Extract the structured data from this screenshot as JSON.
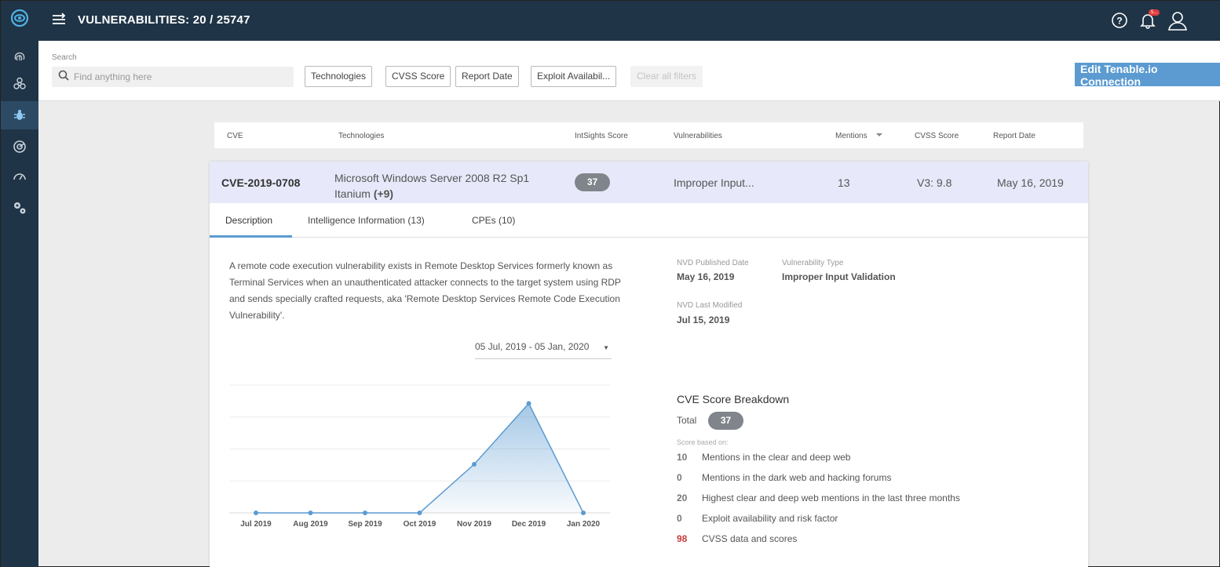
{
  "header": {
    "title": "VULNERABILITIES: 20 / 25747",
    "notification_count": "5..."
  },
  "search": {
    "label": "Search",
    "placeholder": "Find anything here"
  },
  "filters": [
    "Technologies",
    "CVSS Score",
    "Report Date",
    "Exploit Availabil...",
    "Clear all filters"
  ],
  "edit_button": "Edit Tenable.io Connection",
  "columns": [
    "CVE",
    "Technologies",
    "IntSights Score",
    "Vulnerabilities",
    "Mentions",
    "CVSS Score",
    "Report Date"
  ],
  "row": {
    "cve": "CVE-2019-0708",
    "tech": "Microsoft Windows Server 2008 R2 Sp1 Itanium",
    "tech_more": "(+9)",
    "score": "37",
    "vulnerability": "Improper Input...",
    "mentions": "13",
    "cvss": "V3: 9.8",
    "report_date": "May 16, 2019"
  },
  "tabs": [
    "Description",
    "Intelligence Information (13)",
    "CPEs (10)"
  ],
  "description": "A remote code execution vulnerability exists in Remote Desktop Services formerly known as Terminal Services when an unauthenticated attacker connects to the target system using RDP and sends specially crafted requests, aka 'Remote Desktop Services Remote Code Execution Vulnerability'.",
  "date_range": "05 Jul, 2019 - 05 Jan, 2020",
  "details": {
    "published_label": "NVD Published Date",
    "published": "May 16, 2019",
    "type_label": "Vulnerability Type",
    "type": "Improper Input Validation",
    "modified_label": "NVD Last Modified",
    "modified": "Jul 15, 2019"
  },
  "breakdown": {
    "title": "CVE Score Breakdown",
    "total_label": "Total",
    "total": "37",
    "subtitle": "Score based on:",
    "items": [
      {
        "value": "10",
        "label": "Mentions in the clear and deep web"
      },
      {
        "value": "0",
        "label": "Mentions in the dark web and hacking forums"
      },
      {
        "value": "20",
        "label": "Highest clear and deep web mentions in the last three months"
      },
      {
        "value": "0",
        "label": "Exploit availability and risk factor"
      },
      {
        "value": "98",
        "label": "CVSS data and scores"
      }
    ]
  },
  "chart_data": {
    "type": "area",
    "categories": [
      "Jul 2019",
      "Aug 2019",
      "Sep 2019",
      "Oct 2019",
      "Nov 2019",
      "Dec 2019",
      "Jan 2020"
    ],
    "values": [
      0,
      0,
      0,
      0,
      4,
      9,
      0
    ],
    "ylim": [
      0,
      10
    ],
    "grid": true,
    "color": "#5b9bd1"
  },
  "colors": {
    "accent": "#5b9bd1",
    "nav": "#1f3446",
    "row_highlight": "#e7e9fa",
    "alert": "#c43c3c"
  }
}
